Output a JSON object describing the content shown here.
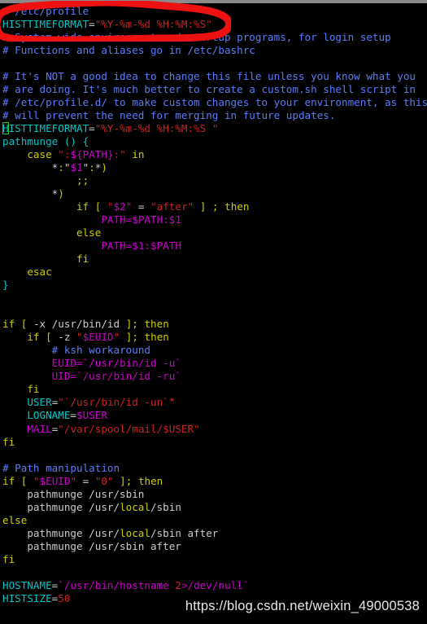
{
  "window": {
    "title_strip_color": "#8a8a8a",
    "background": "#000000"
  },
  "palette": {
    "comment": "#5c7cfa",
    "identifier": "#00c5c7",
    "string": "#cc2222",
    "variable": "#cc00cc",
    "keyword": "#cdcd00",
    "number": "#cc2222",
    "plain": "#cccccc",
    "cursor_outline": "#22cc22",
    "annotation": "#ee1111"
  },
  "annotation": {
    "shape": "hand-drawn-ellipse",
    "color": "#ee1111",
    "encircles_lines": [
      1,
      2,
      3
    ]
  },
  "watermark": {
    "text": "https://blog.csdn.net/weixin_49000538"
  },
  "editor": {
    "cursor": {
      "line": 10,
      "column": 1,
      "char": "H"
    },
    "lines": [
      {
        "n": 1,
        "tokens": [
          {
            "t": "# /etc/profile",
            "c": "comment"
          }
        ]
      },
      {
        "n": 2,
        "tokens": [
          {
            "t": "HISTTIMEFORMAT",
            "c": "ident"
          },
          {
            "t": "=",
            "c": "plain"
          },
          {
            "t": "\"",
            "c": "string"
          },
          {
            "t": "%Y-%m-%d %H:%M:%S",
            "c": "string"
          },
          {
            "t": "\"",
            "c": "string"
          }
        ]
      },
      {
        "n": 3,
        "tokens": [
          {
            "t": "# System wide environment and startup programs, for login setup",
            "c": "comment"
          }
        ]
      },
      {
        "n": 4,
        "tokens": [
          {
            "t": "# Functions and aliases go in /etc/bashrc",
            "c": "comment"
          }
        ]
      },
      {
        "n": 5,
        "tokens": [
          {
            "t": "",
            "c": "plain"
          }
        ]
      },
      {
        "n": 6,
        "tokens": [
          {
            "t": "# It's NOT a good idea to change this file unless you know what you",
            "c": "comment"
          }
        ]
      },
      {
        "n": 7,
        "tokens": [
          {
            "t": "# are doing. It's much better to create a custom.sh shell script in",
            "c": "comment"
          }
        ]
      },
      {
        "n": 8,
        "tokens": [
          {
            "t": "# /etc/profile.d/ to make custom changes to your environment, as this",
            "c": "comment"
          }
        ]
      },
      {
        "n": 9,
        "tokens": [
          {
            "t": "# will prevent the need for merging in future updates.",
            "c": "comment"
          }
        ]
      },
      {
        "n": 10,
        "tokens": [
          {
            "t": "H",
            "c": "ident",
            "cursor": true
          },
          {
            "t": "ISTTIMEFORMAT",
            "c": "ident"
          },
          {
            "t": "=",
            "c": "plain"
          },
          {
            "t": "\"%Y-%m-%d %H:%M:%S \"",
            "c": "string"
          }
        ]
      },
      {
        "n": 11,
        "tokens": [
          {
            "t": "pathmunge () {",
            "c": "ident"
          }
        ]
      },
      {
        "n": 12,
        "tokens": [
          {
            "t": "    ",
            "c": "plain"
          },
          {
            "t": "case",
            "c": "kw"
          },
          {
            "t": " ",
            "c": "plain"
          },
          {
            "t": "\":",
            "c": "string"
          },
          {
            "t": "${PATH}",
            "c": "var"
          },
          {
            "t": ":\"",
            "c": "string"
          },
          {
            "t": " ",
            "c": "plain"
          },
          {
            "t": "in",
            "c": "kw"
          }
        ]
      },
      {
        "n": 13,
        "tokens": [
          {
            "t": "        ",
            "c": "plain"
          },
          {
            "t": "*",
            "c": "plain"
          },
          {
            "t": ":",
            "c": "kw"
          },
          {
            "t": "\"",
            "c": "plain"
          },
          {
            "t": "$1",
            "c": "var"
          },
          {
            "t": "\"",
            "c": "plain"
          },
          {
            "t": ":",
            "c": "kw"
          },
          {
            "t": "*",
            "c": "plain"
          },
          {
            "t": ")",
            "c": "kw"
          }
        ]
      },
      {
        "n": 14,
        "tokens": [
          {
            "t": "            ",
            "c": "plain"
          },
          {
            "t": ";;",
            "c": "kw"
          }
        ]
      },
      {
        "n": 15,
        "tokens": [
          {
            "t": "        ",
            "c": "plain"
          },
          {
            "t": "*",
            "c": "plain"
          },
          {
            "t": ")",
            "c": "kw"
          }
        ]
      },
      {
        "n": 16,
        "tokens": [
          {
            "t": "            ",
            "c": "plain"
          },
          {
            "t": "if",
            "c": "kw"
          },
          {
            "t": " ",
            "c": "plain"
          },
          {
            "t": "[",
            "c": "kw"
          },
          {
            "t": " ",
            "c": "plain"
          },
          {
            "t": "\"",
            "c": "string"
          },
          {
            "t": "$2",
            "c": "var"
          },
          {
            "t": "\"",
            "c": "string"
          },
          {
            "t": " = ",
            "c": "plain"
          },
          {
            "t": "\"after\"",
            "c": "string"
          },
          {
            "t": " ",
            "c": "plain"
          },
          {
            "t": "]",
            "c": "kw"
          },
          {
            "t": " ",
            "c": "plain"
          },
          {
            "t": ";",
            "c": "kw"
          },
          {
            "t": " ",
            "c": "plain"
          },
          {
            "t": "then",
            "c": "kw"
          }
        ]
      },
      {
        "n": 17,
        "tokens": [
          {
            "t": "                ",
            "c": "plain"
          },
          {
            "t": "PATH=$PATH:$1",
            "c": "var"
          }
        ]
      },
      {
        "n": 18,
        "tokens": [
          {
            "t": "            ",
            "c": "plain"
          },
          {
            "t": "else",
            "c": "kw"
          }
        ]
      },
      {
        "n": 19,
        "tokens": [
          {
            "t": "                ",
            "c": "plain"
          },
          {
            "t": "PATH=$1:$PATH",
            "c": "var"
          }
        ]
      },
      {
        "n": 20,
        "tokens": [
          {
            "t": "            ",
            "c": "plain"
          },
          {
            "t": "fi",
            "c": "kw"
          }
        ]
      },
      {
        "n": 21,
        "tokens": [
          {
            "t": "    ",
            "c": "plain"
          },
          {
            "t": "esac",
            "c": "kw"
          }
        ]
      },
      {
        "n": 22,
        "tokens": [
          {
            "t": "}",
            "c": "ident"
          }
        ]
      },
      {
        "n": 23,
        "tokens": [
          {
            "t": "",
            "c": "plain"
          }
        ]
      },
      {
        "n": 24,
        "tokens": [
          {
            "t": "",
            "c": "plain"
          }
        ]
      },
      {
        "n": 25,
        "tokens": [
          {
            "t": "if",
            "c": "kw"
          },
          {
            "t": " ",
            "c": "plain"
          },
          {
            "t": "[",
            "c": "kw"
          },
          {
            "t": " -x /usr/bin/id ",
            "c": "plain"
          },
          {
            "t": "]",
            "c": "kw"
          },
          {
            "t": ";",
            "c": "kw"
          },
          {
            "t": " ",
            "c": "plain"
          },
          {
            "t": "then",
            "c": "kw"
          }
        ]
      },
      {
        "n": 26,
        "tokens": [
          {
            "t": "    ",
            "c": "plain"
          },
          {
            "t": "if",
            "c": "kw"
          },
          {
            "t": " ",
            "c": "plain"
          },
          {
            "t": "[",
            "c": "kw"
          },
          {
            "t": " -z ",
            "c": "plain"
          },
          {
            "t": "\"",
            "c": "string"
          },
          {
            "t": "$EUID",
            "c": "var"
          },
          {
            "t": "\"",
            "c": "string"
          },
          {
            "t": " ",
            "c": "plain"
          },
          {
            "t": "]",
            "c": "kw"
          },
          {
            "t": ";",
            "c": "kw"
          },
          {
            "t": " ",
            "c": "plain"
          },
          {
            "t": "then",
            "c": "kw"
          }
        ]
      },
      {
        "n": 27,
        "tokens": [
          {
            "t": "        ",
            "c": "plain"
          },
          {
            "t": "# ksh workaround",
            "c": "comment"
          }
        ]
      },
      {
        "n": 28,
        "tokens": [
          {
            "t": "        ",
            "c": "plain"
          },
          {
            "t": "EUID=`/usr/bin/id -u`",
            "c": "var"
          }
        ]
      },
      {
        "n": 29,
        "tokens": [
          {
            "t": "        ",
            "c": "plain"
          },
          {
            "t": "UID=`/usr/bin/id -ru`",
            "c": "var"
          }
        ]
      },
      {
        "n": 30,
        "tokens": [
          {
            "t": "    ",
            "c": "plain"
          },
          {
            "t": "fi",
            "c": "kw"
          }
        ]
      },
      {
        "n": 31,
        "tokens": [
          {
            "t": "    ",
            "c": "plain"
          },
          {
            "t": "USER",
            "c": "ident"
          },
          {
            "t": "=",
            "c": "plain"
          },
          {
            "t": "\"`/usr/bin/id -un`\"",
            "c": "string"
          }
        ]
      },
      {
        "n": 32,
        "tokens": [
          {
            "t": "    ",
            "c": "plain"
          },
          {
            "t": "LOGNAME",
            "c": "ident"
          },
          {
            "t": "=",
            "c": "plain"
          },
          {
            "t": "$USER",
            "c": "var"
          }
        ]
      },
      {
        "n": 33,
        "tokens": [
          {
            "t": "    ",
            "c": "plain"
          },
          {
            "t": "MAIL",
            "c": "var"
          },
          {
            "t": "=",
            "c": "plain"
          },
          {
            "t": "\"/var/spool/mail/$USER\"",
            "c": "string"
          }
        ]
      },
      {
        "n": 34,
        "tokens": [
          {
            "t": "fi",
            "c": "kw"
          }
        ]
      },
      {
        "n": 35,
        "tokens": [
          {
            "t": "",
            "c": "plain"
          }
        ]
      },
      {
        "n": 36,
        "tokens": [
          {
            "t": "# Path manipulation",
            "c": "comment"
          }
        ]
      },
      {
        "n": 37,
        "tokens": [
          {
            "t": "if",
            "c": "kw"
          },
          {
            "t": " ",
            "c": "plain"
          },
          {
            "t": "[",
            "c": "kw"
          },
          {
            "t": " ",
            "c": "plain"
          },
          {
            "t": "\"",
            "c": "string"
          },
          {
            "t": "$EUID",
            "c": "var"
          },
          {
            "t": "\"",
            "c": "string"
          },
          {
            "t": " = ",
            "c": "plain"
          },
          {
            "t": "\"0\"",
            "c": "string"
          },
          {
            "t": " ",
            "c": "plain"
          },
          {
            "t": "]",
            "c": "kw"
          },
          {
            "t": ";",
            "c": "kw"
          },
          {
            "t": " ",
            "c": "plain"
          },
          {
            "t": "then",
            "c": "kw"
          }
        ]
      },
      {
        "n": 38,
        "tokens": [
          {
            "t": "    pathmunge /usr/sbin",
            "c": "plain"
          }
        ]
      },
      {
        "n": 39,
        "tokens": [
          {
            "t": "    pathmunge /usr/",
            "c": "plain"
          },
          {
            "t": "local",
            "c": "hl"
          },
          {
            "t": "/sbin",
            "c": "plain"
          }
        ]
      },
      {
        "n": 40,
        "tokens": [
          {
            "t": "else",
            "c": "kw"
          }
        ]
      },
      {
        "n": 41,
        "tokens": [
          {
            "t": "    pathmunge /usr/",
            "c": "plain"
          },
          {
            "t": "local",
            "c": "hl"
          },
          {
            "t": "/sbin after",
            "c": "plain"
          }
        ]
      },
      {
        "n": 42,
        "tokens": [
          {
            "t": "    pathmunge /usr/sbin after",
            "c": "plain"
          }
        ]
      },
      {
        "n": 43,
        "tokens": [
          {
            "t": "fi",
            "c": "kw"
          }
        ]
      },
      {
        "n": 44,
        "tokens": [
          {
            "t": "",
            "c": "plain"
          }
        ]
      },
      {
        "n": 45,
        "tokens": [
          {
            "t": "HOSTNAME",
            "c": "ident"
          },
          {
            "t": "=",
            "c": "plain"
          },
          {
            "t": "`/usr/bin/hostname ",
            "c": "var"
          },
          {
            "t": "2",
            "c": "num"
          },
          {
            "t": ">/dev/null`",
            "c": "var"
          }
        ]
      },
      {
        "n": 46,
        "tokens": [
          {
            "t": "HISTSIZE",
            "c": "ident"
          },
          {
            "t": "=",
            "c": "plain"
          },
          {
            "t": "50",
            "c": "num"
          }
        ]
      }
    ]
  }
}
